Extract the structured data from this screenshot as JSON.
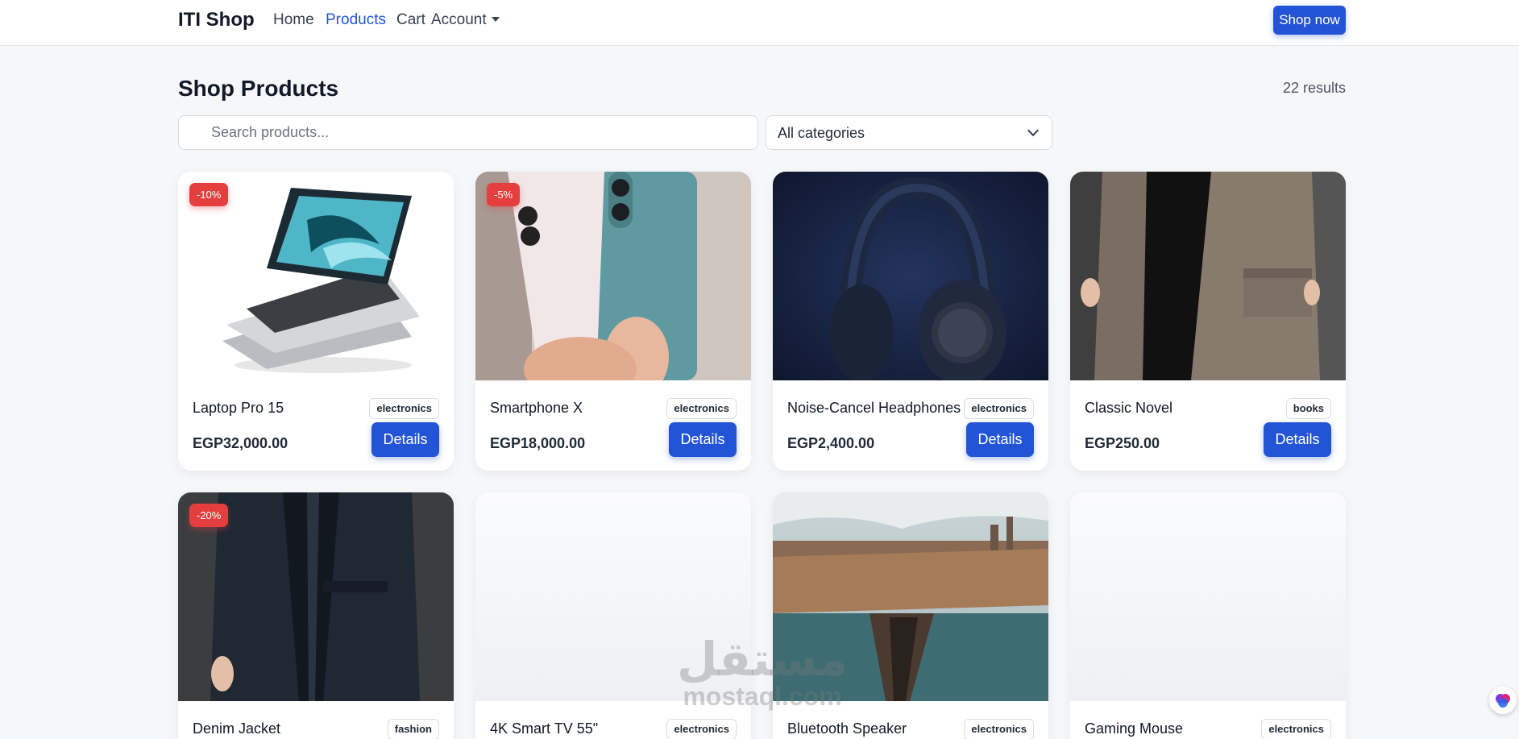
{
  "navbar": {
    "brand": "ITI Shop",
    "links": [
      {
        "label": "Home",
        "active": false
      },
      {
        "label": "Products",
        "active": true
      },
      {
        "label": "Cart",
        "active": false
      },
      {
        "label": "Account",
        "active": false,
        "dropdown": true
      }
    ],
    "cta": "Shop now"
  },
  "header": {
    "title": "Shop Products",
    "results": "22 results"
  },
  "filters": {
    "search_placeholder": "Search products...",
    "category_selected": "All categories"
  },
  "products": [
    {
      "name": "Laptop Pro 15",
      "category": "electronics",
      "price": "EGP32,000.00",
      "discount": "-10%",
      "details_label": "Details"
    },
    {
      "name": "Smartphone X",
      "category": "electronics",
      "price": "EGP18,000.00",
      "discount": "-5%",
      "details_label": "Details"
    },
    {
      "name": "Noise-Cancel Headphones",
      "category": "electronics",
      "price": "EGP2,400.00",
      "discount": null,
      "details_label": "Details"
    },
    {
      "name": "Classic Novel",
      "category": "books",
      "price": "EGP250.00",
      "discount": null,
      "details_label": "Details"
    },
    {
      "name": "Denim Jacket",
      "category": "fashion",
      "discount": "-20%"
    },
    {
      "name": "4K Smart TV 55\"",
      "category": "electronics",
      "discount": null
    },
    {
      "name": "Bluetooth Speaker",
      "category": "electronics",
      "discount": null
    },
    {
      "name": "Gaming Mouse",
      "category": "electronics",
      "discount": null
    }
  ],
  "watermark": {
    "arabic": "مستقل",
    "latin": "mostaql.com"
  },
  "colors": {
    "primary": "#2454d6",
    "discount": "#e53e3e",
    "background": "#f6f7f9"
  }
}
